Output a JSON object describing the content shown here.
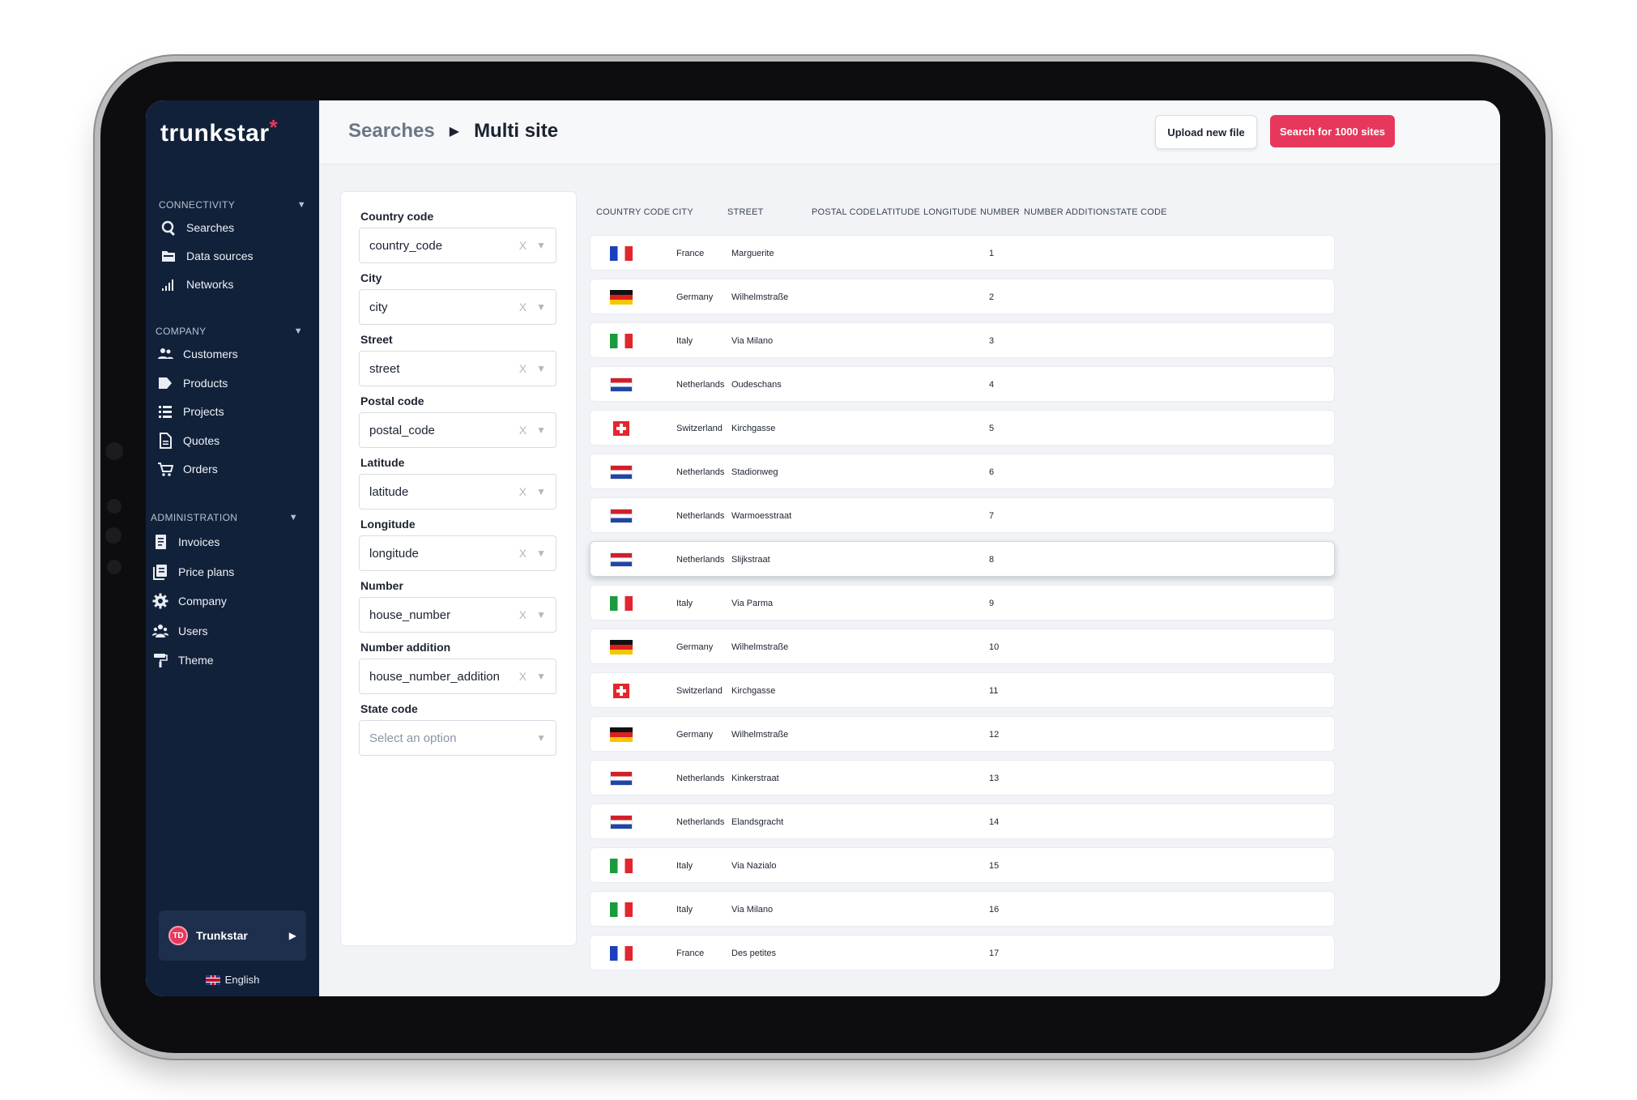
{
  "app": {
    "logo": "trunkstar",
    "logo_mark": "*"
  },
  "sidebar": {
    "sections": [
      {
        "title": "CONNECTIVITY",
        "items": [
          {
            "label": "Searches",
            "icon": "search-icon"
          },
          {
            "label": "Data sources",
            "icon": "folder-icon"
          },
          {
            "label": "Networks",
            "icon": "signal-bars-icon"
          }
        ]
      },
      {
        "title": "COMPANY",
        "items": [
          {
            "label": "Customers",
            "icon": "people-icon"
          },
          {
            "label": "Products",
            "icon": "tag-icon"
          },
          {
            "label": "Projects",
            "icon": "list-icon"
          },
          {
            "label": "Quotes",
            "icon": "document-icon"
          },
          {
            "label": "Orders",
            "icon": "cart-icon"
          }
        ]
      },
      {
        "title": "ADMINISTRATION",
        "items": [
          {
            "label": "Invoices",
            "icon": "invoice-icon"
          },
          {
            "label": "Price plans",
            "icon": "price-plan-icon"
          },
          {
            "label": "Company",
            "icon": "gear-icon"
          },
          {
            "label": "Users",
            "icon": "users-icon"
          },
          {
            "label": "Theme",
            "icon": "paint-roller-icon"
          }
        ]
      }
    ],
    "account": {
      "initials": "TD",
      "name": "Trunkstar"
    },
    "language": "English"
  },
  "header": {
    "breadcrumb_parent": "Searches",
    "breadcrumb_current": "Multi site",
    "upload_button": "Upload new file",
    "search_button": "Search for 1000 sites"
  },
  "mapping": {
    "fields": [
      {
        "label": "Country code",
        "value": "country_code",
        "placeholder": false
      },
      {
        "label": "City",
        "value": "city",
        "placeholder": false
      },
      {
        "label": "Street",
        "value": "street",
        "placeholder": false
      },
      {
        "label": "Postal code",
        "value": "postal_code",
        "placeholder": false
      },
      {
        "label": "Latitude",
        "value": "latitude",
        "placeholder": false
      },
      {
        "label": "Longitude",
        "value": "longitude",
        "placeholder": false
      },
      {
        "label": "Number",
        "value": "house_number",
        "placeholder": false
      },
      {
        "label": "Number addition",
        "value": "house_number_addition",
        "placeholder": false
      },
      {
        "label": "State code",
        "value": "Select an option",
        "placeholder": true
      }
    ],
    "clear_glyph": "X",
    "dropdown_glyph": "▼"
  },
  "table": {
    "columns": [
      "COUNTRY CODE",
      "CITY",
      "STREET",
      "POSTAL CODE",
      "LATITUDE",
      "LONGITUDE",
      "NUMBER",
      "NUMBER ADDITION",
      "STATE CODE"
    ],
    "rows": [
      {
        "flag": "fr",
        "city": "France",
        "street": "Marguerite",
        "number": "1"
      },
      {
        "flag": "de",
        "city": "Germany",
        "street": "Wilhelmstraße",
        "number": "2"
      },
      {
        "flag": "it",
        "city": "Italy",
        "street": "Via Milano",
        "number": "3"
      },
      {
        "flag": "nl",
        "city": "Netherlands",
        "street": "Oudeschans",
        "number": "4"
      },
      {
        "flag": "ch",
        "city": "Switzerland",
        "street": "Kirchgasse",
        "number": "5"
      },
      {
        "flag": "nl",
        "city": "Netherlands",
        "street": "Stadionweg",
        "number": "6"
      },
      {
        "flag": "nl",
        "city": "Netherlands",
        "street": "Warmoesstraat",
        "number": "7"
      },
      {
        "flag": "nl",
        "city": "Netherlands",
        "street": "Slijkstraat",
        "number": "8",
        "active": true
      },
      {
        "flag": "it",
        "city": "Italy",
        "street": "Via Parma",
        "number": "9"
      },
      {
        "flag": "de",
        "city": "Germany",
        "street": "Wilhelmstraße",
        "number": "10"
      },
      {
        "flag": "ch",
        "city": "Switzerland",
        "street": "Kirchgasse",
        "number": "11"
      },
      {
        "flag": "de",
        "city": "Germany",
        "street": "Wilhelmstraße",
        "number": "12"
      },
      {
        "flag": "nl",
        "city": "Netherlands",
        "street": "Kinkerstraat",
        "number": "13"
      },
      {
        "flag": "nl",
        "city": "Netherlands",
        "street": "Elandsgracht",
        "number": "14"
      },
      {
        "flag": "it",
        "city": "Italy",
        "street": "Via Nazialo",
        "number": "15"
      },
      {
        "flag": "it",
        "city": "Italy",
        "street": "Via Milano",
        "number": "16"
      },
      {
        "flag": "fr",
        "city": "France",
        "street": "Des petites",
        "number": "17"
      }
    ]
  },
  "colors": {
    "brand": "#e8375c",
    "sidebar": "#12213a"
  }
}
